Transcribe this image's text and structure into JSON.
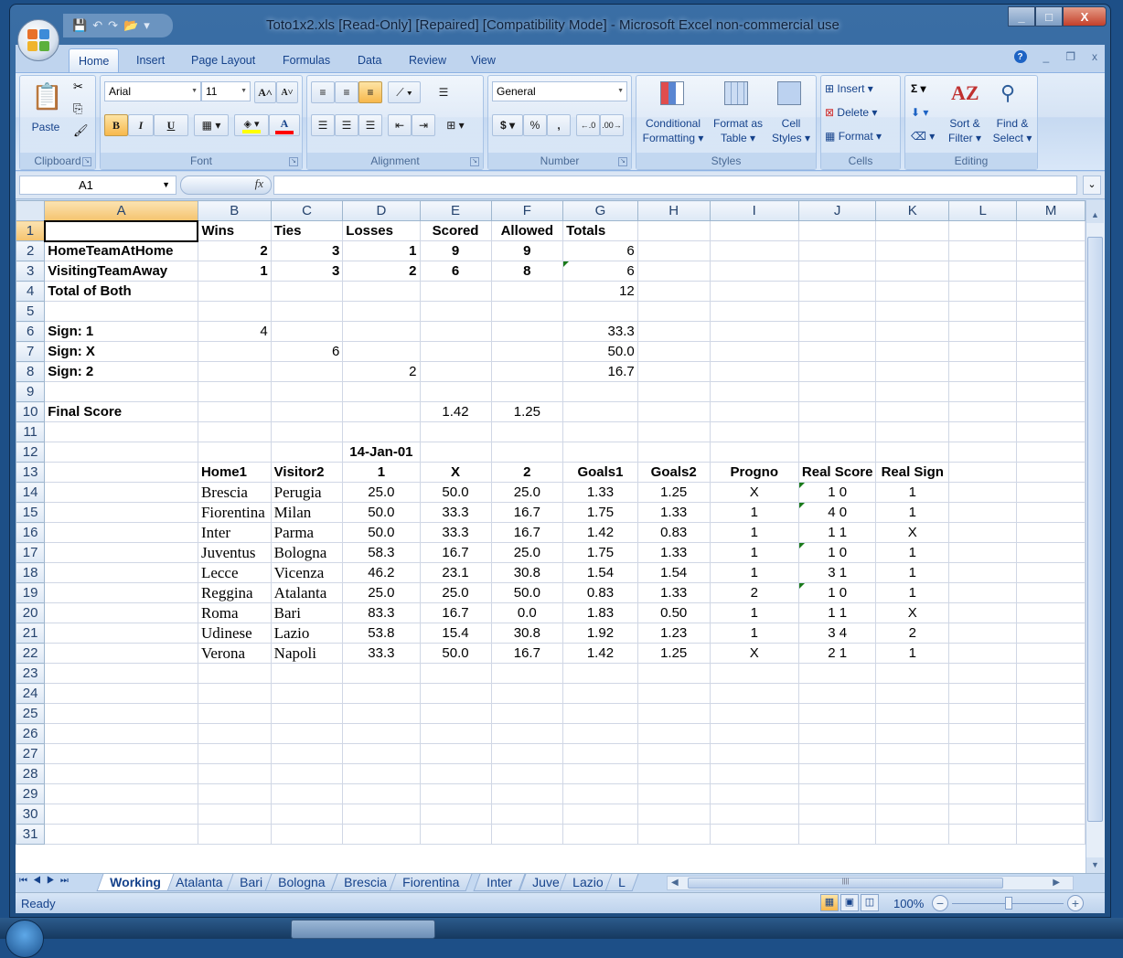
{
  "window": {
    "title": "Toto1x2.xls  [Read-Only] [Repaired]  [Compatibility Mode] - Microsoft Excel non-commercial use",
    "controls": {
      "minimize": "_",
      "maximize": "□",
      "close": "X"
    }
  },
  "quick_access": [
    "save-icon",
    "undo-icon",
    "redo-icon",
    "open-icon",
    "customize-icon"
  ],
  "ribbon_tabs": [
    "Home",
    "Insert",
    "Page Layout",
    "Formulas",
    "Data",
    "Review",
    "View"
  ],
  "active_tab": "Home",
  "ribbon": {
    "clipboard": {
      "label": "Clipboard",
      "paste": "Paste"
    },
    "font": {
      "label": "Font",
      "name": "Arial",
      "size": "11",
      "bold": "B",
      "italic": "I",
      "underline": "U",
      "grow": "A",
      "shrink": "A",
      "font_color": "A",
      "highlight_color": "#ffff00",
      "text_color": "#ff0000"
    },
    "alignment": {
      "label": "Alignment"
    },
    "number": {
      "label": "Number",
      "format": "General",
      "currency": "$",
      "percent": "%",
      "comma": ","
    },
    "styles": {
      "label": "Styles",
      "conditional": "Conditional",
      "conditional2": "Formatting",
      "format_as": "Format as",
      "format_as2": "Table",
      "cell": "Cell",
      "cell2": "Styles"
    },
    "cells": {
      "label": "Cells",
      "insert": "Insert",
      "delete": "Delete",
      "format": "Format"
    },
    "editing": {
      "label": "Editing",
      "sum": "Σ",
      "sort": "Sort &",
      "sort2": "Filter",
      "find": "Find &",
      "find2": "Select"
    }
  },
  "formula_bar": {
    "name_box": "A1",
    "fx": "fx",
    "content": ""
  },
  "columns": [
    "A",
    "B",
    "C",
    "D",
    "E",
    "F",
    "G",
    "H",
    "I",
    "J",
    "K",
    "L",
    "M"
  ],
  "selected_cell": "A1",
  "rows": [
    {
      "n": "1",
      "cells": [
        "",
        "Wins",
        "Ties",
        "Losses",
        "Scored",
        "Allowed",
        "Totals",
        "",
        "",
        "",
        "",
        "",
        ""
      ]
    },
    {
      "n": "2",
      "cells": [
        "HomeTeamAtHome",
        "2",
        "3",
        "1",
        "9",
        "9",
        "6",
        "",
        "",
        "",
        "",
        "",
        ""
      ]
    },
    {
      "n": "3",
      "cells": [
        "VisitingTeamAway",
        "1",
        "3",
        "2",
        "6",
        "8",
        "6",
        "",
        "",
        "",
        "",
        "",
        ""
      ]
    },
    {
      "n": "4",
      "cells": [
        "Total of Both",
        "",
        "",
        "",
        "",
        "",
        "12",
        "",
        "",
        "",
        "",
        "",
        ""
      ]
    },
    {
      "n": "5",
      "cells": [
        "",
        "",
        "",
        "",
        "",
        "",
        "",
        "",
        "",
        "",
        "",
        "",
        ""
      ]
    },
    {
      "n": "6",
      "cells": [
        "Sign: 1",
        "4",
        "",
        "",
        "",
        "",
        "33.3",
        "",
        "",
        "",
        "",
        "",
        ""
      ]
    },
    {
      "n": "7",
      "cells": [
        "Sign: X",
        "",
        "6",
        "",
        "",
        "",
        "50.0",
        "",
        "",
        "",
        "",
        "",
        ""
      ]
    },
    {
      "n": "8",
      "cells": [
        "Sign: 2",
        "",
        "",
        "2",
        "",
        "",
        "16.7",
        "",
        "",
        "",
        "",
        "",
        ""
      ]
    },
    {
      "n": "9",
      "cells": [
        "",
        "",
        "",
        "",
        "",
        "",
        "",
        "",
        "",
        "",
        "",
        "",
        ""
      ]
    },
    {
      "n": "10",
      "cells": [
        "Final Score",
        "",
        "",
        "",
        "1.42",
        "1.25",
        "",
        "",
        "",
        "",
        "",
        "",
        ""
      ]
    },
    {
      "n": "11",
      "cells": [
        "",
        "",
        "",
        "",
        "",
        "",
        "",
        "",
        "",
        "",
        "",
        "",
        ""
      ]
    },
    {
      "n": "12",
      "cells": [
        "",
        "",
        "",
        "14-Jan-01",
        "",
        "",
        "",
        "",
        "",
        "",
        "",
        "",
        ""
      ]
    },
    {
      "n": "13",
      "cells": [
        "",
        "Home1",
        "Visitor2",
        "1",
        "X",
        "2",
        "Goals1",
        "Goals2",
        "Progno",
        "Real Score",
        "Real Sign",
        "",
        ""
      ]
    },
    {
      "n": "14",
      "cells": [
        "",
        "Brescia",
        "Perugia",
        "25.0",
        "50.0",
        "25.0",
        "1.33",
        "1.25",
        "X",
        "1 0",
        "1",
        "",
        ""
      ]
    },
    {
      "n": "15",
      "cells": [
        "",
        "Fiorentina",
        "Milan",
        "50.0",
        "33.3",
        "16.7",
        "1.75",
        "1.33",
        "1",
        "4 0",
        "1",
        "",
        ""
      ]
    },
    {
      "n": "16",
      "cells": [
        "",
        "Inter",
        "Parma",
        "50.0",
        "33.3",
        "16.7",
        "1.42",
        "0.83",
        "1",
        "1 1",
        "X",
        "",
        ""
      ]
    },
    {
      "n": "17",
      "cells": [
        "",
        "Juventus",
        "Bologna",
        "58.3",
        "16.7",
        "25.0",
        "1.75",
        "1.33",
        "1",
        "1 0",
        "1",
        "",
        ""
      ]
    },
    {
      "n": "18",
      "cells": [
        "",
        "Lecce",
        "Vicenza",
        "46.2",
        "23.1",
        "30.8",
        "1.54",
        "1.54",
        "1",
        "3 1",
        "1",
        "",
        ""
      ]
    },
    {
      "n": "19",
      "cells": [
        "",
        "Reggina",
        "Atalanta",
        "25.0",
        "25.0",
        "50.0",
        "0.83",
        "1.33",
        "2",
        "1 0",
        "1",
        "",
        ""
      ]
    },
    {
      "n": "20",
      "cells": [
        "",
        "Roma",
        "Bari",
        "83.3",
        "16.7",
        "0.0",
        "1.83",
        "0.50",
        "1",
        "1 1",
        "X",
        "",
        ""
      ]
    },
    {
      "n": "21",
      "cells": [
        "",
        "Udinese",
        "Lazio",
        "53.8",
        "15.4",
        "30.8",
        "1.92",
        "1.23",
        "1",
        "3 4",
        "2",
        "",
        ""
      ]
    },
    {
      "n": "22",
      "cells": [
        "",
        "Verona",
        "Napoli",
        "33.3",
        "50.0",
        "16.7",
        "1.42",
        "1.25",
        "X",
        "2 1",
        "1",
        "",
        ""
      ]
    },
    {
      "n": "23",
      "cells": [
        "",
        "",
        "",
        "",
        "",
        "",
        "",
        "",
        "",
        "",
        "",
        "",
        ""
      ]
    },
    {
      "n": "24",
      "cells": [
        "",
        "",
        "",
        "",
        "",
        "",
        "",
        "",
        "",
        "",
        "",
        "",
        ""
      ]
    },
    {
      "n": "25",
      "cells": [
        "",
        "",
        "",
        "",
        "",
        "",
        "",
        "",
        "",
        "",
        "",
        "",
        ""
      ]
    },
    {
      "n": "26",
      "cells": [
        "",
        "",
        "",
        "",
        "",
        "",
        "",
        "",
        "",
        "",
        "",
        "",
        ""
      ]
    },
    {
      "n": "27",
      "cells": [
        "",
        "",
        "",
        "",
        "",
        "",
        "",
        "",
        "",
        "",
        "",
        "",
        ""
      ]
    },
    {
      "n": "28",
      "cells": [
        "",
        "",
        "",
        "",
        "",
        "",
        "",
        "",
        "",
        "",
        "",
        "",
        ""
      ]
    },
    {
      "n": "29",
      "cells": [
        "",
        "",
        "",
        "",
        "",
        "",
        "",
        "",
        "",
        "",
        "",
        "",
        ""
      ]
    },
    {
      "n": "30",
      "cells": [
        "",
        "",
        "",
        "",
        "",
        "",
        "",
        "",
        "",
        "",
        "",
        "",
        ""
      ]
    },
    {
      "n": "31",
      "cells": [
        "",
        "",
        "",
        "",
        "",
        "",
        "",
        "",
        "",
        "",
        "",
        "",
        ""
      ]
    }
  ],
  "sheet_tabs": [
    "Working",
    "Atalanta",
    "Bari",
    "Bologna",
    "Brescia",
    "Fiorentina",
    "Inter",
    "Juve",
    "Lazio",
    "L"
  ],
  "active_sheet": "Working",
  "status": {
    "text": "Ready",
    "zoom": "100%"
  }
}
